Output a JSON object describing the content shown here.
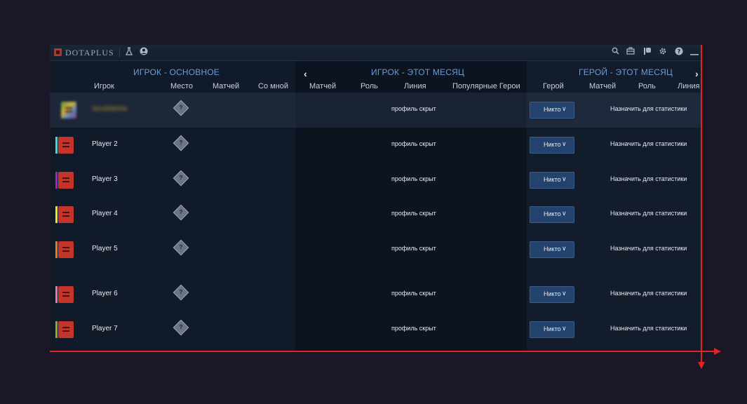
{
  "app": {
    "title": "DOTAPLUS"
  },
  "toolbar": {
    "icons": [
      "flask-icon",
      "user-icon",
      "search-icon",
      "briefcase-icon",
      "flag-icon",
      "gear-icon",
      "help-icon",
      "minimize-icon"
    ]
  },
  "sections": {
    "player_main": "ИГРОК - ОСНОВНОЕ",
    "player_month": "ИГРОК - ЭТОТ МЕСЯЦ",
    "hero_month": "ГЕРОЙ - ЭТОТ МЕСЯЦ"
  },
  "columns": {
    "player": "Игрок",
    "place": "Место",
    "matches": "Матчей",
    "with_me": "Со мной",
    "month_matches": "Матчей",
    "role": "Роль",
    "lane": "Линия",
    "popular_heroes": "Популярные Герои",
    "hero": "Герой",
    "hero_matches": "Матчей",
    "hero_role": "Роль",
    "hero_lane": "Линия"
  },
  "rows": [
    {
      "name": "SenkMethe",
      "hidden": "профиль скрыт",
      "hero": "Никто",
      "assign": "Назначить для статистики",
      "color": "#3a8f4a"
    },
    {
      "name": "Player 2",
      "hidden": "профиль скрыт",
      "hero": "Никто",
      "assign": "Назначить для статистики",
      "color": "#36e0d8"
    },
    {
      "name": "Player 3",
      "hidden": "профиль скрыт",
      "hero": "Никто",
      "assign": "Назначить для статистики",
      "color": "#a61ec4"
    },
    {
      "name": "Player 4",
      "hidden": "профиль скрыт",
      "hero": "Никто",
      "assign": "Назначить для статистики",
      "color": "#f2e21c"
    },
    {
      "name": "Player 5",
      "hidden": "профиль скрыт",
      "hero": "Никто",
      "assign": "Назначить для статистики",
      "color": "#f07a1a"
    },
    {
      "name": "Player 6",
      "hidden": "профиль скрыт",
      "hero": "Никто",
      "assign": "Назначить для статистики",
      "color": "#f26fa8"
    },
    {
      "name": "Player 7",
      "hidden": "профиль скрыт",
      "hero": "Никто",
      "assign": "Назначить для статистики",
      "color": "#9aa82c"
    }
  ],
  "rank_glyph": "?",
  "chevron": "∨"
}
